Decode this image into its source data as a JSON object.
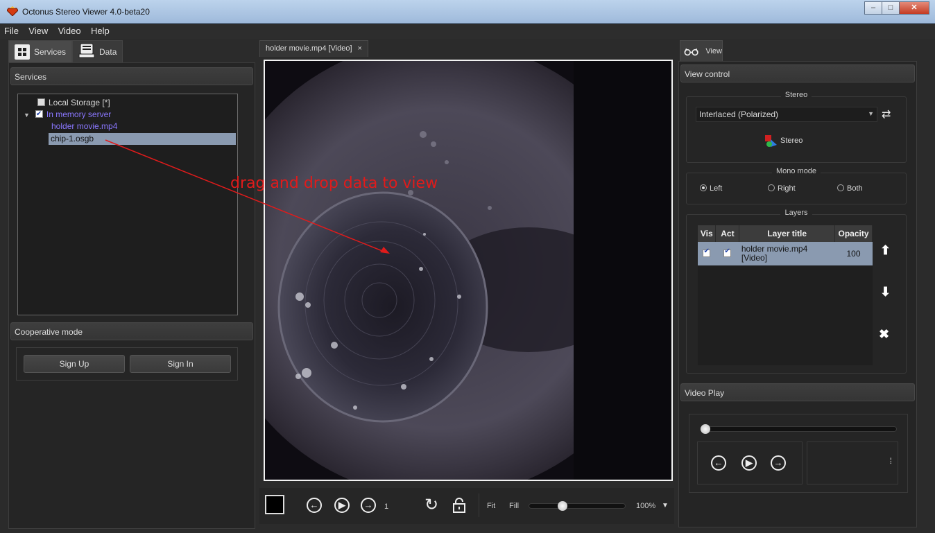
{
  "window": {
    "title": "Octonus Stereo Viewer 4.0-beta20",
    "minimize": "–",
    "maximize": "□",
    "close": "✕"
  },
  "menu": [
    "File",
    "View",
    "Video",
    "Help"
  ],
  "left": {
    "tabs": [
      {
        "label": "Services",
        "icon": "services-grid-icon"
      },
      {
        "label": "Data",
        "icon": "data-document-icon"
      }
    ],
    "services_header": "Services",
    "tree": [
      {
        "label": "Local Storage [*]",
        "checked": false
      },
      {
        "label": "In memory server",
        "checked": true,
        "expanded": true
      },
      {
        "label": "holder movie.mp4"
      },
      {
        "label": "chip-1.osgb",
        "selected": true
      }
    ],
    "coop_header": "Cooperative mode",
    "sign_up": "Sign Up",
    "sign_in": "Sign In"
  },
  "center": {
    "doc_tab": "holder movie.mp4 [Video]",
    "doc_tab_close": "×",
    "annotation": "drag and drop data to view",
    "frame_number": "1",
    "fit_label": "Fit",
    "fill_label": "Fill",
    "zoom": "100%",
    "zoom_slider_value": 0.33
  },
  "right": {
    "tab": "View",
    "view_control_header": "View control",
    "stereo_group": "Stereo",
    "stereo_mode": "Interlaced (Polarized)",
    "stereo_button": "Stereo",
    "mono_group": "Mono mode",
    "mono_options": [
      "Left",
      "Right",
      "Both"
    ],
    "mono_selected": "Left",
    "layers_group": "Layers",
    "layers_columns": [
      "Vis",
      "Act",
      "Layer title",
      "Opacity"
    ],
    "layers_rows": [
      {
        "vis": true,
        "act": true,
        "title_line1": "holder movie.mp4",
        "title_line2": "[Video]",
        "opacity": "100"
      }
    ],
    "video_play_header": "Video Play",
    "video_progress": 0.0
  },
  "colors": {
    "accent_selection": "#8a9ab0",
    "annotation": "#e01b1b",
    "link_purple": "#8a77ff"
  }
}
